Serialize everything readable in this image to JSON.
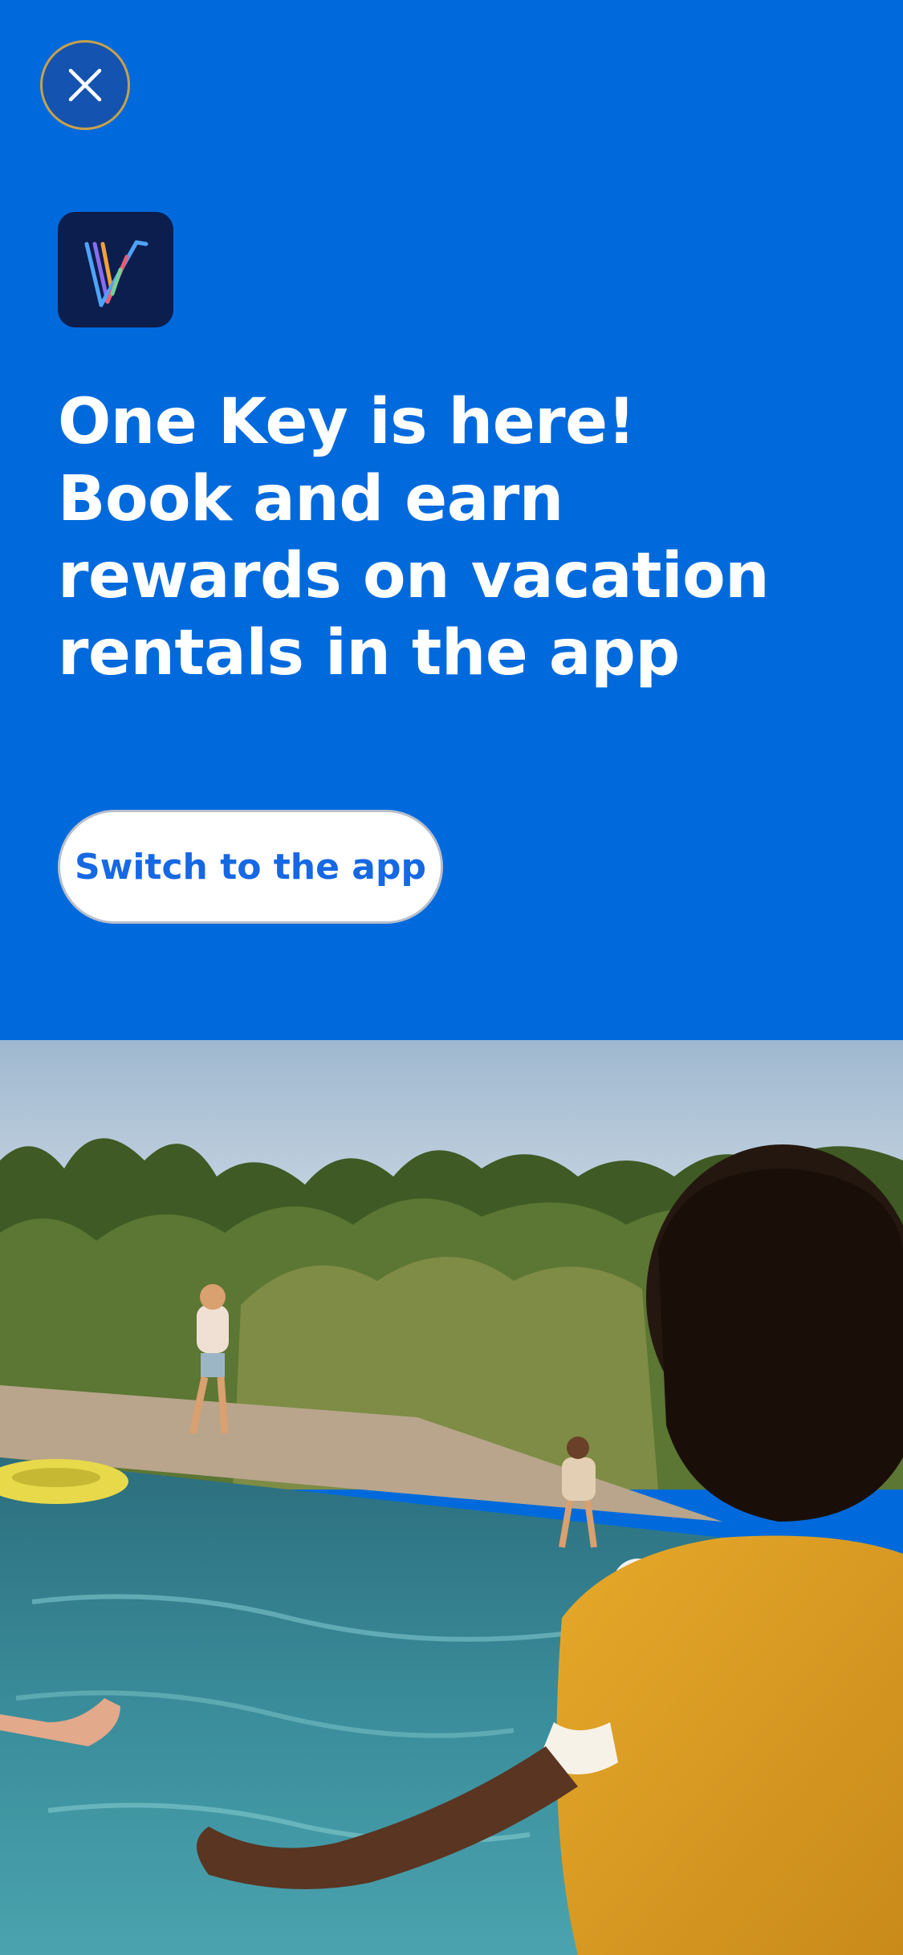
{
  "close": {
    "icon": "close-icon",
    "label": "Close"
  },
  "app_icon": {
    "icon": "vrbo-app-icon"
  },
  "headline": "One Key is here! Book and earn rewards on vacation rentals in the app",
  "cta": {
    "label": "Switch to the app"
  },
  "photo": {
    "subject": "poolside-vacation-photo"
  },
  "colors": {
    "background": "#006ADC",
    "cta_text": "#1668E3",
    "cta_bg": "#FFFFFF",
    "headline": "#FFFFFF",
    "close_border": "#C9A04A"
  }
}
